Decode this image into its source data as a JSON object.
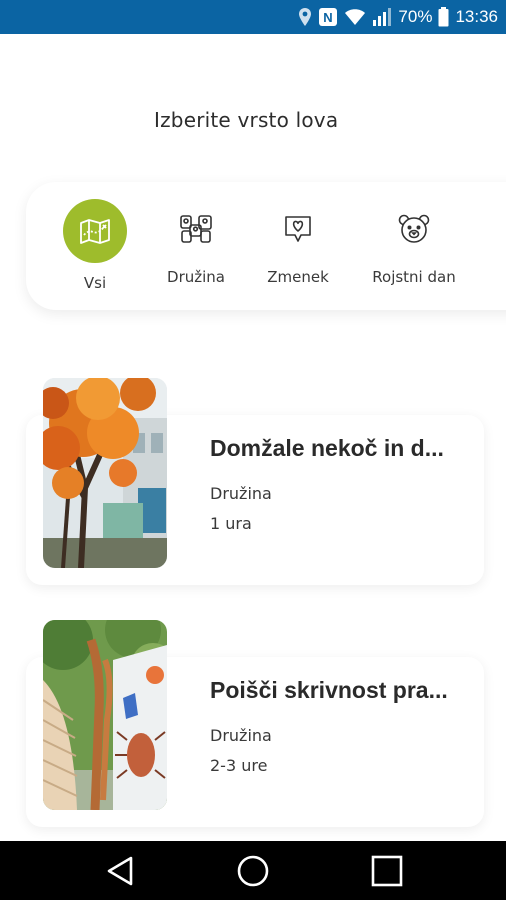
{
  "status_bar": {
    "battery_percent": "70%",
    "time": "13:36",
    "icons": [
      "location-icon",
      "nfc-icon",
      "wifi-icon",
      "signal-icon",
      "battery-icon"
    ]
  },
  "screen": {
    "title": "Izberite vrsto lova"
  },
  "categories": [
    {
      "label": "Vsi",
      "icon": "map-icon",
      "active": true
    },
    {
      "label": "Družina",
      "icon": "family-icon",
      "active": false
    },
    {
      "label": "Zmenek",
      "icon": "heart-chat-icon",
      "active": false
    },
    {
      "label": "Rojstni dan",
      "icon": "teddy-bear-icon",
      "active": false
    }
  ],
  "hunts": [
    {
      "title": "Domžale nekoč in d...",
      "audience": "Družina",
      "duration": "1 ura"
    },
    {
      "title": "Poišči skrivnost pra...",
      "audience": "Družina",
      "duration": "2-3 ure"
    }
  ],
  "colors": {
    "status_bar": "#0b64a3",
    "accent": "#9ebc2c",
    "nav_bar": "#000000"
  }
}
